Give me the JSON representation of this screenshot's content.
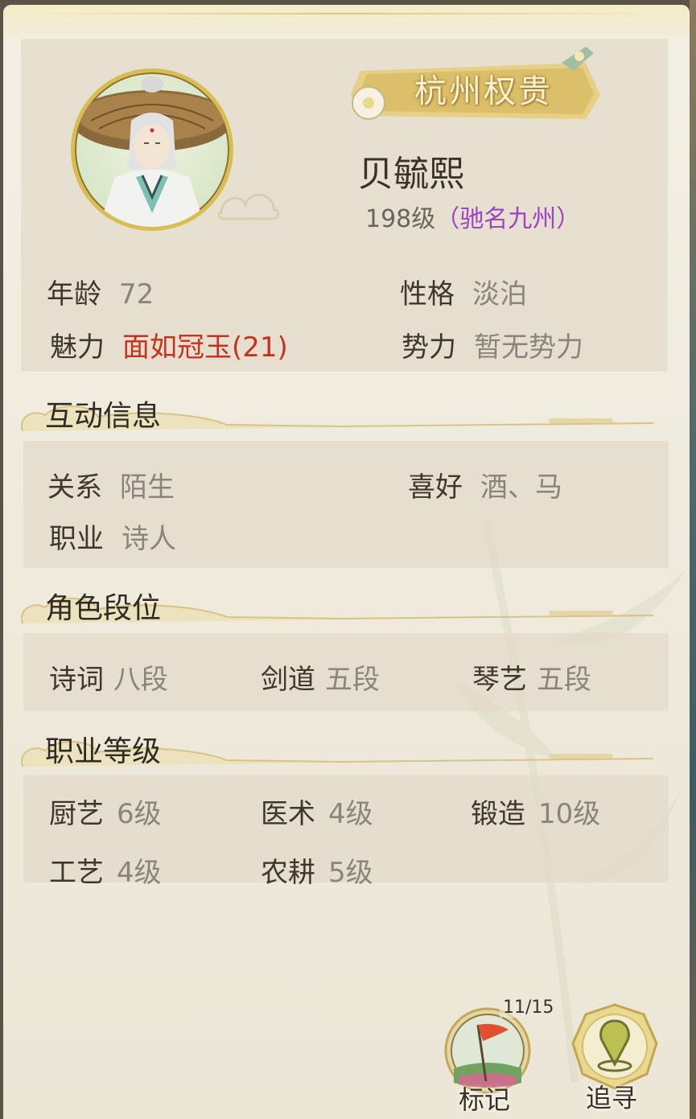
{
  "profile": {
    "title_banner": "杭州权贵",
    "name": "贝毓熙",
    "level": "198级",
    "fame": "（驰名九州）",
    "age_label": "年龄",
    "age_value": "72",
    "personality_label": "性格",
    "personality_value": "淡泊",
    "charm_label": "魅力",
    "charm_value": "面如冠玉(21)",
    "faction_label": "势力",
    "faction_value": "暂无势力"
  },
  "interaction": {
    "title": "互动信息",
    "relation_label": "关系",
    "relation_value": "陌生",
    "hobby_label": "喜好",
    "hobby_value": "酒、马",
    "job_label": "职业",
    "job_value": "诗人"
  },
  "rank": {
    "title": "角色段位",
    "items": [
      {
        "label": "诗词",
        "value": "八段"
      },
      {
        "label": "剑道",
        "value": "五段"
      },
      {
        "label": "琴艺",
        "value": "五段"
      }
    ]
  },
  "career": {
    "title": "职业等级",
    "items": [
      {
        "label": "厨艺",
        "value": "6级"
      },
      {
        "label": "医术",
        "value": "4级"
      },
      {
        "label": "锻造",
        "value": "10级"
      },
      {
        "label": "工艺",
        "value": "4级"
      },
      {
        "label": "农耕",
        "value": "5级"
      }
    ]
  },
  "actions": {
    "mark_label": "标记",
    "mark_counter": "11/15",
    "seek_label": "追寻"
  },
  "colors": {
    "accent_gold": "#d8bd52",
    "charm_red": "#c5331f",
    "fame_purple": "#9b44c4"
  },
  "icons": {
    "avatar": "character-portrait",
    "mark": "red-flag-icon",
    "seek": "location-pin-icon"
  }
}
